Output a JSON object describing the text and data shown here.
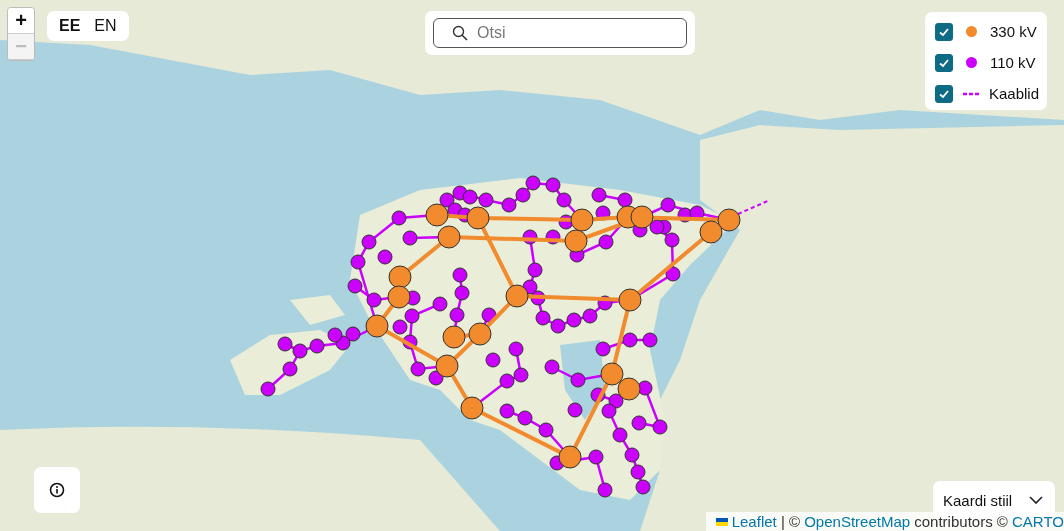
{
  "zoom_controls": [
    {
      "label": "+",
      "disabled": false
    },
    {
      "label": "−",
      "disabled": true
    }
  ],
  "languages": [
    {
      "label": "EE",
      "selected": true
    },
    {
      "label": "EN",
      "selected": false
    }
  ],
  "search": {
    "placeholder": "Otsi"
  },
  "legend": [
    {
      "kind": "dot",
      "label": "330 kV",
      "color": "#f28a2e",
      "checked": true
    },
    {
      "kind": "dot",
      "label": "110 kV",
      "color": "#cc00ff",
      "checked": true
    },
    {
      "kind": "dashed",
      "label": "Kaablid",
      "color": "#cc00ff",
      "checked": true
    }
  ],
  "style_menu": {
    "label": "Kaardi stiil"
  },
  "attribution": [
    {
      "kind": "link",
      "text": "Leaflet"
    },
    {
      "kind": "text",
      "text": " | © "
    },
    {
      "kind": "link",
      "text": "OpenStreetMap"
    },
    {
      "kind": "text",
      "text": " contributors © "
    },
    {
      "kind": "link",
      "text": "CARTO"
    }
  ]
}
